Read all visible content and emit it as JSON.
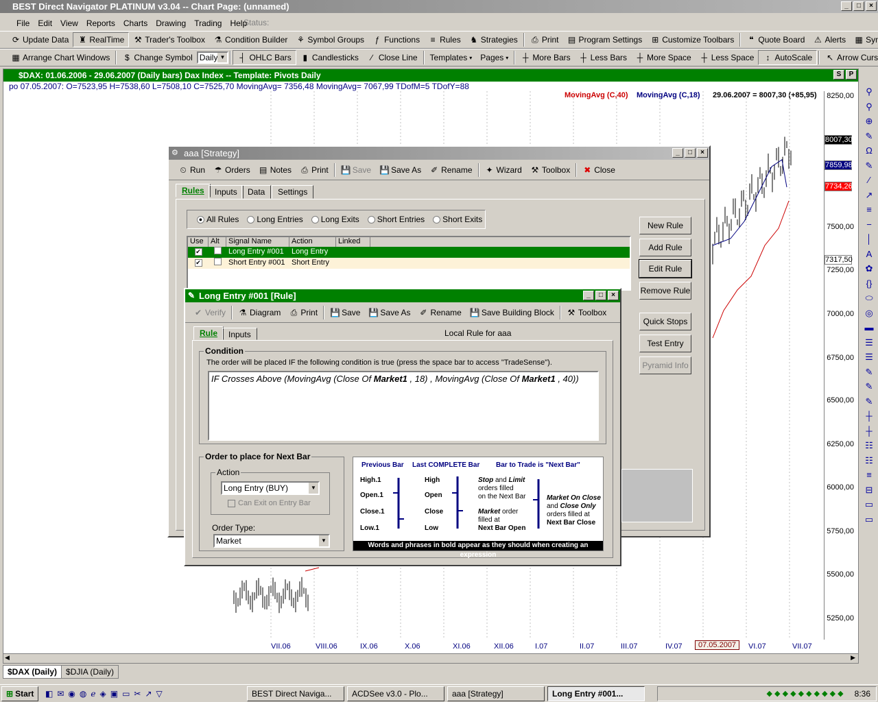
{
  "window": {
    "title": "BEST Direct Navigator PLATINUM v3.04  --  Chart Page: (unnamed)",
    "status": "Status:"
  },
  "menu": [
    "File",
    "Edit",
    "View",
    "Reports",
    "Charts",
    "Drawing",
    "Trading",
    "Help"
  ],
  "toolbar1": [
    "Update Data",
    "RealTime",
    "Trader's Toolbox",
    "Condition Builder",
    "Symbol Groups",
    "Functions",
    "Rules",
    "Strategies",
    "Print",
    "Program Settings",
    "Customize Toolbars",
    "Quote Board",
    "Alerts",
    "Symbol Grid"
  ],
  "toolbar2": {
    "arrange": "Arrange Chart Windows",
    "change": "Change Symbol",
    "period": "Daily",
    "ohlc": "OHLC Bars",
    "candles": "Candlesticks",
    "closeline": "Close Line",
    "templates": "Templates",
    "pages": "Pages",
    "more": "More Bars",
    "less": "Less Bars",
    "morespace": "More Space",
    "lessspace": "Less Space",
    "autoscale": "AutoScale",
    "cursor": "Arrow Cursor"
  },
  "chart": {
    "title": "$DAX:  01.06.2006 - 29.06.2007  (Daily bars)   Dax Index  --  Template: Pivots Daily",
    "info": "po   07.05.2007:  O=7523,95   H=7538,60   L=7508,10   C=7525,70   MovingAvg= 7356,48   MovingAvg= 7067,99   TDofM=5   TDofY=88",
    "legend_ma40": "MovingAvg (C,40)",
    "legend_ma18": "MovingAvg (C,18)",
    "legend_last": "29.06.2007 = 8007,30 (+85,95)",
    "colors": {
      "ma40": "#cc0000",
      "ma18": "#000080",
      "title_bg": "#008000"
    },
    "yticks": [
      "8250,00",
      "7500,00",
      "7250,00",
      "7000,00",
      "6750,00",
      "6500,00",
      "6250,00",
      "6000,00",
      "5750,00",
      "5500,00",
      "5250,00"
    ],
    "ymarkers": [
      "8007,30",
      "7859,98",
      "7734,26",
      "7317,50"
    ],
    "xticks": [
      "VII.06",
      "VIII.06",
      "IX.06",
      "X.06",
      "XI.06",
      "XII.06",
      "I.07",
      "II.07",
      "III.07",
      "IV.07",
      "07.05.2007",
      "VI.07",
      "VII.07"
    ],
    "tabs": [
      "$DAX (Daily)",
      "$DJIA (Daily)"
    ]
  },
  "strategy": {
    "title": "aaa   [Strategy]",
    "tools": [
      "Run",
      "Orders",
      "Notes",
      "Print",
      "Save",
      "Save As",
      "Rename",
      "Wizard",
      "Toolbox",
      "Close"
    ],
    "tabs": [
      "Rules",
      "Inputs",
      "Data",
      "Settings"
    ],
    "radios": [
      "All Rules",
      "Long Entries",
      "Long Exits",
      "Short Entries",
      "Short Exits"
    ],
    "columns": [
      "Use",
      "Alt",
      "Signal Name",
      "Action",
      "Linked"
    ],
    "rows": [
      {
        "name": "Long Entry #001",
        "action": "Long Entry"
      },
      {
        "name": "Short Entry #001",
        "action": "Short Entry"
      }
    ],
    "buttons": [
      "New Rule",
      "Add Rule",
      "Edit Rule",
      "Remove Rule",
      "Quick Stops",
      "Test Entry",
      "Pyramid Info"
    ]
  },
  "rule": {
    "title": "Long Entry #001   [Rule]",
    "tools": [
      "Verify",
      "Diagram",
      "Print",
      "Save",
      "Save As",
      "Rename",
      "Save Building Block",
      "Toolbox"
    ],
    "tabs": [
      "Rule",
      "Inputs"
    ],
    "local": "Local Rule for aaa",
    "cond_title": "Condition",
    "cond_desc": "The order will be placed IF the following condition is true  (press the space bar to access \"TradeSense\").",
    "expr_if": "IF Crosses Above (MovingAvg (Close Of ",
    "expr_m1": "Market1",
    "expr_mid": " , 18) , MovingAvg (Close Of ",
    "expr_m2": "Market1",
    "expr_end": " , 40))",
    "order_title": "Order to place for Next Bar",
    "action_label": "Action",
    "action_value": "Long Entry (BUY)",
    "can_exit": "Can Exit on Entry Bar",
    "ordertype_label": "Order Type:",
    "ordertype_value": "Market",
    "diagram": {
      "h1": "Previous Bar",
      "h2": "Last COMPLETE Bar",
      "h3": "Bar to Trade is \"Next Bar\"",
      "l1": [
        "High.1",
        "Open.1",
        "Close.1",
        "Low.1"
      ],
      "l2": [
        "High",
        "Open",
        "Close",
        "Low"
      ],
      "stop1": "Stop",
      "stop2": " and ",
      "stop3": "Limit",
      "stop4": "orders filled",
      "stop5": "on the Next Bar",
      "mkt1": "Market",
      "mkt2": " order",
      "mkt3": "filled at",
      "mkt4": "Next Bar Open",
      "moc1": "Market On Close",
      "moc2": "and ",
      "moc3": "Close Only",
      "moc4": "orders filled at",
      "moc5": "Next Bar Close",
      "footer": "Words and phrases in bold appear as they should when creating an expression"
    }
  },
  "taskbar": {
    "start": "Start",
    "items": [
      "BEST Direct Naviga...",
      "ACDSee v3.0 - Plo...",
      "aaa   [Strategy]",
      "Long Entry #001..."
    ],
    "time": "8:36"
  }
}
